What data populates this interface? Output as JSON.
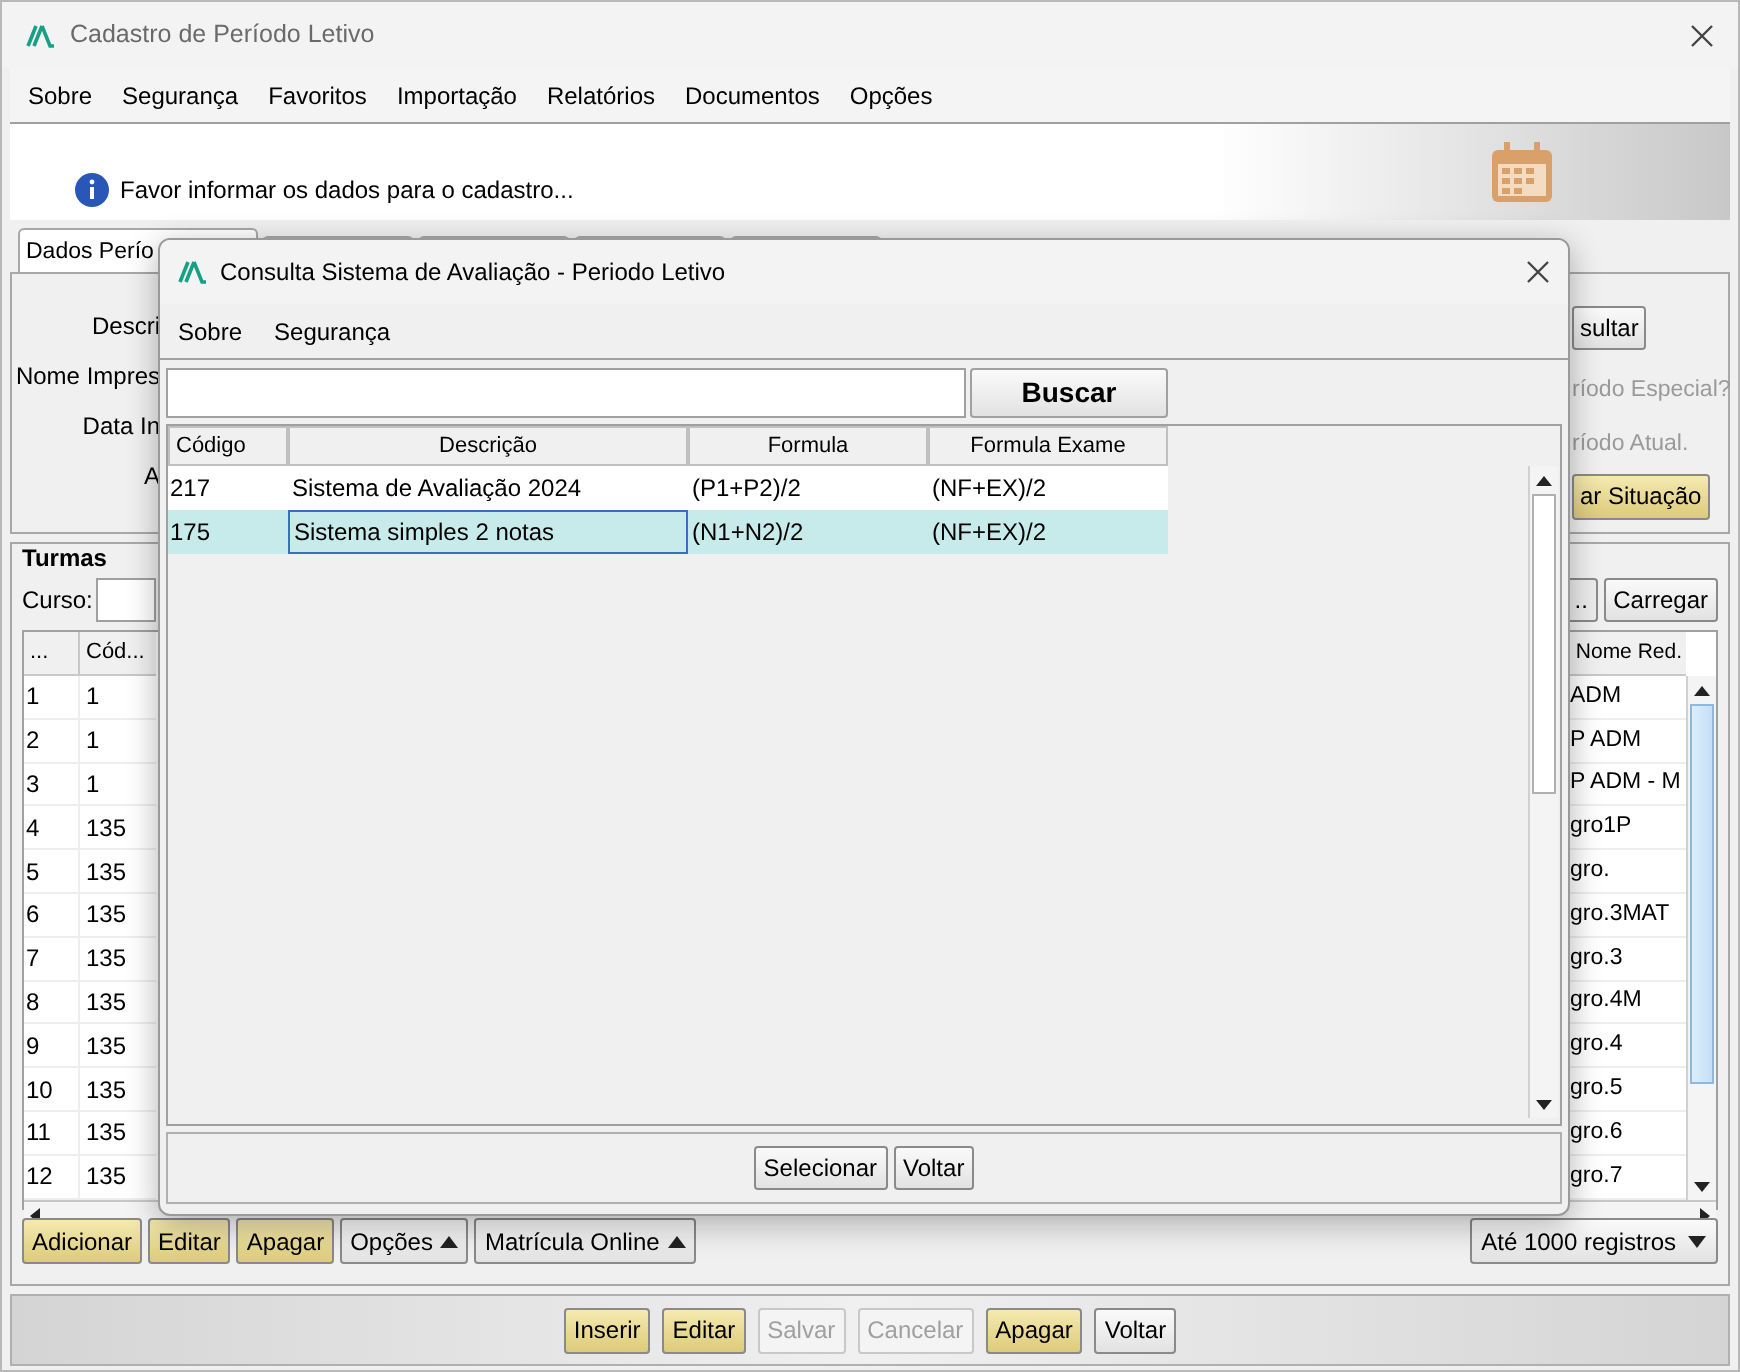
{
  "window": {
    "title": "Cadastro de Período Letivo"
  },
  "menu": [
    "Sobre",
    "Segurança",
    "Favoritos",
    "Importação",
    "Relatórios",
    "Documentos",
    "Opções"
  ],
  "info": {
    "message": "Favor informar os dados para o cadastro..."
  },
  "tabs": [
    {
      "label": "Dados Perío",
      "selected": true
    },
    {
      "selected": false
    },
    {
      "selected": false
    },
    {
      "selected": false
    },
    {
      "selected": false
    }
  ],
  "form": {
    "labels": [
      "Descri",
      "Nome Impres",
      "Data In",
      "A"
    ],
    "consult_button": "sultar",
    "special_label": "ríodo Especial?",
    "current_label": "ríodo Atual.",
    "situation_button": "ar Situação"
  },
  "turmas": {
    "title": "Turmas",
    "course_label": "Curso:",
    "browse_button": "..",
    "load_button": "Carregar",
    "columns": [
      "...",
      "Cód...",
      "Nome Red."
    ],
    "rows": [
      {
        "num": "1",
        "cod": "1",
        "name": "ADM"
      },
      {
        "num": "2",
        "cod": "1",
        "name": "P ADM"
      },
      {
        "num": "3",
        "cod": "1",
        "name": "P ADM - M"
      },
      {
        "num": "4",
        "cod": "135",
        "name": "gro1P"
      },
      {
        "num": "5",
        "cod": "135",
        "name": "gro."
      },
      {
        "num": "6",
        "cod": "135",
        "name": "gro.3MAT"
      },
      {
        "num": "7",
        "cod": "135",
        "name": "gro.3"
      },
      {
        "num": "8",
        "cod": "135",
        "name": "gro.4M"
      },
      {
        "num": "9",
        "cod": "135",
        "name": "gro.4"
      },
      {
        "num": "10",
        "cod": "135",
        "name": "gro.5"
      },
      {
        "num": "11",
        "cod": "135",
        "name": "gro.6"
      },
      {
        "num": "12",
        "cod": "135",
        "name": "gro.7"
      }
    ],
    "actions": [
      {
        "label": "Adicionar",
        "kind": "primary"
      },
      {
        "label": "Editar",
        "kind": "primary"
      },
      {
        "label": "Apagar",
        "kind": "primary"
      },
      {
        "label": "Opções",
        "kind": "menu"
      },
      {
        "label": "Matrícula Online",
        "kind": "menu"
      }
    ],
    "limit": "Até 1000 registros"
  },
  "footer": [
    {
      "label": "Inserir",
      "kind": "primary",
      "disabled": false
    },
    {
      "label": "Editar",
      "kind": "primary",
      "disabled": false
    },
    {
      "label": "Salvar",
      "kind": "normal",
      "disabled": true
    },
    {
      "label": "Cancelar",
      "kind": "normal",
      "disabled": true
    },
    {
      "label": "Apagar",
      "kind": "primary",
      "disabled": false
    },
    {
      "label": "Voltar",
      "kind": "normal",
      "disabled": false
    }
  ],
  "dialog": {
    "title": "Consulta Sistema de Avaliação - Periodo Letivo",
    "menu": [
      "Sobre",
      "Segurança"
    ],
    "search": {
      "button": "Buscar"
    },
    "columns": [
      "Código",
      "Descrição",
      "Formula",
      "Formula Exame"
    ],
    "rows": [
      {
        "code": "217",
        "description": "Sistema de Avaliação 2024",
        "formula": "(P1+P2)/2",
        "exam_formula": "(NF+EX)/2",
        "selected": false
      },
      {
        "code": "175",
        "description": "Sistema simples 2 notas",
        "formula": "(N1+N2)/2",
        "exam_formula": "(NF+EX)/2",
        "selected": true
      }
    ],
    "buttons": [
      "Selecionar",
      "Voltar"
    ]
  }
}
